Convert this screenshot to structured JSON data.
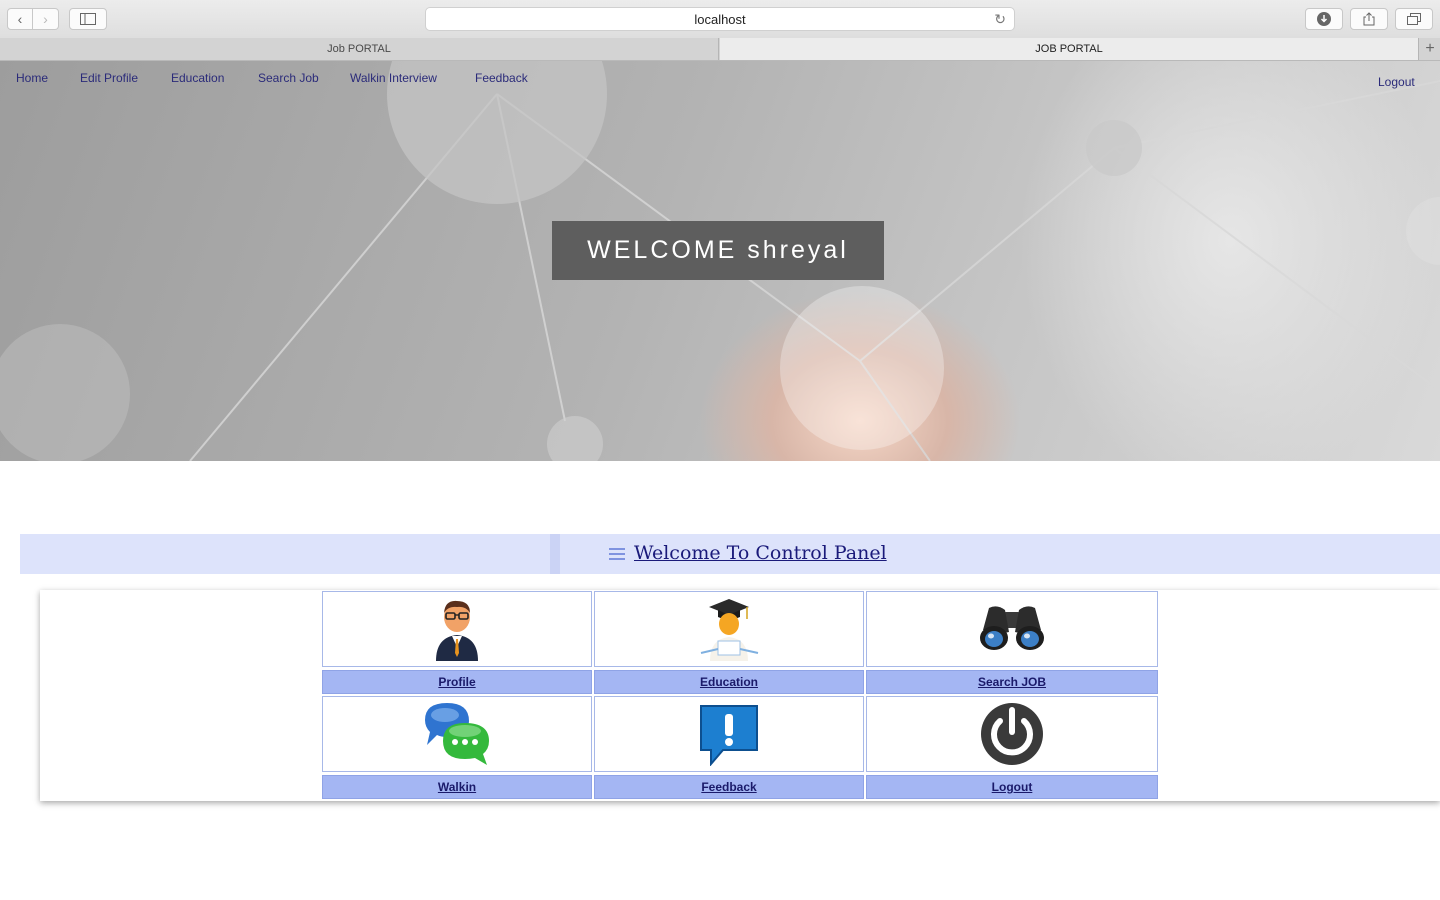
{
  "browser": {
    "url": "localhost",
    "tabs": [
      {
        "label": "Job PORTAL"
      },
      {
        "label": "JOB PORTAL"
      }
    ],
    "new_tab_symbol": "+"
  },
  "nav": {
    "items": [
      {
        "label": "Home"
      },
      {
        "label": "Edit Profile"
      },
      {
        "label": "Education"
      },
      {
        "label": "Search Job"
      },
      {
        "label": "Walkin Interview"
      },
      {
        "label": "Feedback"
      }
    ],
    "logout": "Logout"
  },
  "hero": {
    "welcome": "WELCOME shreyal"
  },
  "control_panel": {
    "title": "Welcome To Control Panel",
    "tiles": [
      {
        "label": "Profile",
        "icon": "profile-icon"
      },
      {
        "label": "Education",
        "icon": "graduate-icon"
      },
      {
        "label": "Search JOB",
        "icon": "binoculars-icon"
      },
      {
        "label": "Walkin",
        "icon": "chat-bubbles-icon"
      },
      {
        "label": "Feedback",
        "icon": "exclamation-bubble-icon"
      },
      {
        "label": "Logout",
        "icon": "power-icon"
      }
    ]
  },
  "colors": {
    "nav_link": "#2b2b7a",
    "welcome_bg": "#5e5e5e",
    "cp_bar": "#dde3fb",
    "tile_label_bg": "#a4b6f3"
  }
}
